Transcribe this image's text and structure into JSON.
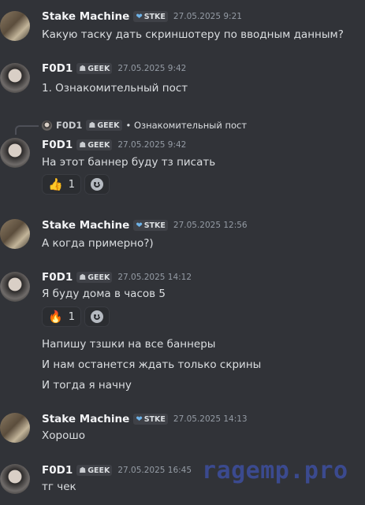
{
  "messages": [
    {
      "username": "Stake Machine",
      "tag": "STKE",
      "time": "27.05.2025 9:21",
      "text": "Какую таску дать скриншотеру по вводным данным?"
    },
    {
      "username": "F0D1",
      "tag": "GEEK",
      "time": "27.05.2025 9:42",
      "text": "1. Ознакомительный пост"
    },
    {
      "reply": {
        "username": "F0D1",
        "tag": "GEEK",
        "text": "• Ознакомительный пост"
      },
      "username": "F0D1",
      "tag": "GEEK",
      "time": "27.05.2025 9:42",
      "text": "На этот баннер буду тз писать",
      "reactions": [
        {
          "emoji": "👍",
          "count": "1"
        }
      ]
    },
    {
      "username": "Stake Machine",
      "tag": "STKE",
      "time": "27.05.2025 12:56",
      "text": "А когда примерно?)"
    },
    {
      "username": "F0D1",
      "tag": "GEEK",
      "time": "27.05.2025 14:12",
      "text": "Я буду дома в часов 5",
      "reactions": [
        {
          "emoji": "🔥",
          "count": "1"
        }
      ],
      "followups": [
        "Напишу тзшки на все баннеры",
        "И нам останется ждать только скрины",
        "И тогда я начну"
      ]
    },
    {
      "username": "Stake Machine",
      "tag": "STKE",
      "time": "27.05.2025 14:13",
      "text": "Хорошо"
    },
    {
      "username": "F0D1",
      "tag": "GEEK",
      "time": "27.05.2025 16:45",
      "text": "тг чек"
    }
  ],
  "icons": {
    "stke": "shield-heart-icon",
    "geek": "robot-icon",
    "add_reaction": "add-reaction-icon"
  },
  "colors": {
    "background": "#313338",
    "username": "#f2f3f5",
    "text": "#dbdee1",
    "timestamp": "#949ba4",
    "watermark": "#3b4a8f"
  },
  "watermark": "ragemp.pro"
}
